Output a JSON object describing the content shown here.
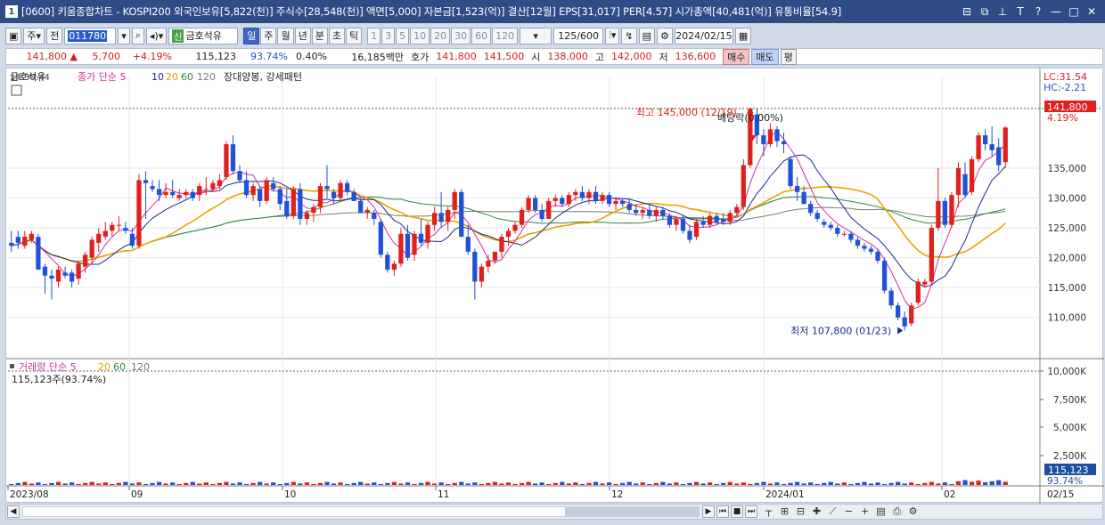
{
  "window": {
    "icon_label": "1",
    "title": "[0600] 키움종합차트 - KOSPI200 외국인보유[5,822(천)] 주식수[28,548(천)] 액면[5,000] 자본금[1,523(억)] 결산[12월] EPS[31,017] PER[4.57] 시가총액[40,481(억)] 유통비율[54.9]",
    "controls": [
      "⊟",
      "⧉",
      "⊥",
      "T",
      "?",
      "—",
      "□",
      "✕"
    ]
  },
  "toolbar": {
    "period_main": "주",
    "prev_label": "전",
    "code": "011780",
    "stock_name": "금호석유",
    "stock_badge": "신",
    "periods": [
      "일",
      "주",
      "월",
      "년",
      "분",
      "초",
      "틱"
    ],
    "active_period": "일",
    "intervals": [
      "1",
      "3",
      "5",
      "10",
      "20",
      "30",
      "60",
      "120"
    ],
    "count": "125/600",
    "date": "2024/02/15"
  },
  "quote": {
    "price": "141,800 ▲",
    "change": "5,700",
    "change_pct": "+4.19%",
    "volume": "115,123",
    "vol_ratio": "93.74%",
    "turnover": "0.40%",
    "amount": "16,185백만",
    "bid_label": "호가",
    "ask1": "141,800",
    "ask2": "141,500",
    "open_label": "시",
    "open": "138,000",
    "high_label": "고",
    "high": "142,000",
    "low_label": "저",
    "low": "136,600",
    "buy_label": "매수",
    "sell_label": "매도",
    "flat_label": "평"
  },
  "chart": {
    "legend_stock": "금호석유",
    "legend_label": "종가 단순",
    "ma_periods": [
      "5",
      "10",
      "20",
      "60",
      "120"
    ],
    "pattern": "장대양봉, 강세패턴",
    "overlay_tag": "14:30:44",
    "lc": "LC:31.54",
    "hc": "HC:-2.21",
    "last_price": "141,800",
    "last_pct": "4.19%",
    "high_ann": "최고 145,000 (12/19)",
    "low_ann": "최저 107,800 (01/23)",
    "div_ann": "배당락(0.00%)",
    "price_ticks": [
      "135,000",
      "130,000",
      "125,000",
      "120,000",
      "115,000",
      "110,000"
    ],
    "vol_legend_label": "거래량 단순",
    "vol_ma": [
      "5",
      "20",
      "60",
      "120"
    ],
    "vol_info": "115,123주(93.74%)",
    "vol_ticks": [
      "10,000K",
      "7,500K",
      "5,000K",
      "2,500K"
    ],
    "vol_last": "115,123",
    "vol_last_pct": "93.74%",
    "x_labels": [
      "2023/08",
      "09",
      "10",
      "11",
      "12",
      "2024/01",
      "02",
      "02/15"
    ],
    "colors": {
      "up": "#e0201c",
      "down": "#1f52d6",
      "ma5": "#d02fa0",
      "ma10": "#1a2a8c",
      "ma20": "#e8a400",
      "ma60": "#2d8a3a",
      "ma120": "#7a7a7a"
    }
  },
  "chart_data": {
    "type": "candlestick",
    "title": "",
    "ylim": [
      104000,
      149000
    ],
    "ohlc": [
      [
        122500,
        124500,
        121000,
        122000
      ],
      [
        123500,
        124500,
        121500,
        122500
      ],
      [
        122000,
        124500,
        121500,
        123500
      ],
      [
        123000,
        124500,
        122500,
        124000
      ],
      [
        123500,
        124000,
        118000,
        118000
      ],
      [
        118500,
        119000,
        114000,
        117000
      ],
      [
        117000,
        118000,
        113000,
        116500
      ],
      [
        116000,
        118500,
        115000,
        118000
      ],
      [
        117500,
        118500,
        116500,
        117000
      ],
      [
        117500,
        118000,
        115000,
        116000
      ],
      [
        116500,
        119500,
        115500,
        119000
      ],
      [
        118500,
        121000,
        117500,
        120500
      ],
      [
        120000,
        123500,
        119000,
        123000
      ],
      [
        122500,
        125000,
        121000,
        124000
      ],
      [
        123500,
        126000,
        123000,
        124500
      ],
      [
        124500,
        126000,
        123500,
        125500
      ],
      [
        125500,
        127000,
        124500,
        125500
      ],
      [
        125000,
        126000,
        124000,
        124500
      ],
      [
        124000,
        125000,
        121500,
        122000
      ],
      [
        122000,
        134000,
        121500,
        133000
      ],
      [
        133000,
        134500,
        126500,
        132500
      ],
      [
        132000,
        133000,
        131000,
        131500
      ],
      [
        131500,
        133000,
        129500,
        130500
      ],
      [
        130500,
        132500,
        130000,
        131000
      ],
      [
        131000,
        133000,
        130000,
        130500
      ],
      [
        130000,
        131500,
        129500,
        130500
      ],
      [
        130500,
        131500,
        130000,
        131000
      ],
      [
        131000,
        131500,
        129500,
        130000
      ],
      [
        130500,
        132500,
        129500,
        132000
      ],
      [
        131500,
        133500,
        130500,
        131500
      ],
      [
        131500,
        133000,
        131000,
        132500
      ],
      [
        132000,
        134000,
        131500,
        133000
      ],
      [
        133500,
        139500,
        133000,
        139000
      ],
      [
        139000,
        140500,
        134000,
        134500
      ],
      [
        134500,
        135500,
        132500,
        133000
      ],
      [
        133000,
        134500,
        130000,
        130500
      ],
      [
        130500,
        132500,
        129500,
        132000
      ],
      [
        131500,
        132000,
        128500,
        129500
      ],
      [
        129500,
        133500,
        129000,
        133000
      ],
      [
        132500,
        133500,
        131000,
        131500
      ],
      [
        131500,
        132000,
        128000,
        129000
      ],
      [
        129500,
        131500,
        126500,
        127000
      ],
      [
        127000,
        132000,
        126500,
        131500
      ],
      [
        131500,
        132500,
        125500,
        126500
      ],
      [
        126500,
        128000,
        125500,
        127500
      ],
      [
        127500,
        129000,
        126000,
        128500
      ],
      [
        128500,
        132500,
        127500,
        132000
      ],
      [
        132000,
        135500,
        130000,
        131500
      ],
      [
        131000,
        131500,
        129000,
        130000
      ],
      [
        130000,
        133000,
        129500,
        132500
      ],
      [
        132500,
        133000,
        130500,
        131000
      ],
      [
        131000,
        131500,
        129500,
        129500
      ],
      [
        129500,
        130000,
        127500,
        127500
      ],
      [
        127500,
        128500,
        126500,
        128000
      ],
      [
        127500,
        128000,
        125500,
        126500
      ],
      [
        126000,
        126500,
        120000,
        120500
      ],
      [
        120500,
        121000,
        117500,
        118000
      ],
      [
        118000,
        119500,
        117000,
        119000
      ],
      [
        119000,
        125000,
        118500,
        124000
      ],
      [
        124000,
        125500,
        119500,
        120000
      ],
      [
        120500,
        124500,
        119500,
        124000
      ],
      [
        124000,
        126500,
        122000,
        122500
      ],
      [
        122500,
        126000,
        121500,
        125500
      ],
      [
        125500,
        128500,
        124500,
        127500
      ],
      [
        127500,
        131000,
        125000,
        126000
      ],
      [
        126000,
        128500,
        124500,
        128000
      ],
      [
        128000,
        131500,
        126500,
        131000
      ],
      [
        131000,
        131500,
        123500,
        123500
      ],
      [
        123500,
        125500,
        120500,
        121000
      ],
      [
        121000,
        121500,
        113000,
        116000
      ],
      [
        116000,
        119000,
        115000,
        118500
      ],
      [
        118500,
        120500,
        117500,
        119500
      ],
      [
        119500,
        121000,
        119000,
        121000
      ],
      [
        121000,
        124000,
        120000,
        123500
      ],
      [
        123500,
        125000,
        122000,
        124500
      ],
      [
        124500,
        126000,
        124000,
        125500
      ],
      [
        125500,
        128500,
        125000,
        128000
      ],
      [
        128000,
        130500,
        127500,
        130000
      ],
      [
        130000,
        130500,
        127500,
        128000
      ],
      [
        128000,
        129000,
        126000,
        126500
      ],
      [
        126500,
        130000,
        126500,
        129500
      ],
      [
        129500,
        130500,
        128500,
        130000
      ],
      [
        130000,
        130500,
        128500,
        129000
      ],
      [
        129000,
        131000,
        128500,
        130500
      ],
      [
        130500,
        131500,
        129500,
        131000
      ],
      [
        131000,
        132000,
        129500,
        130000
      ],
      [
        130000,
        131500,
        129000,
        131000
      ],
      [
        131000,
        132000,
        129000,
        129500
      ],
      [
        129500,
        131000,
        129000,
        130500
      ],
      [
        130500,
        131000,
        128500,
        129000
      ],
      [
        129000,
        130000,
        128000,
        129500
      ],
      [
        129500,
        130000,
        128500,
        129000
      ],
      [
        129000,
        130000,
        127500,
        128000
      ],
      [
        128000,
        129000,
        127000,
        127500
      ],
      [
        127500,
        128500,
        126500,
        128000
      ],
      [
        128000,
        129000,
        126500,
        127000
      ],
      [
        127000,
        128500,
        126000,
        128000
      ],
      [
        128000,
        128500,
        126500,
        127000
      ],
      [
        127000,
        127500,
        125000,
        125500
      ],
      [
        125500,
        127000,
        124500,
        126500
      ],
      [
        126500,
        127000,
        124000,
        124500
      ],
      [
        124500,
        125500,
        122500,
        123000
      ],
      [
        123500,
        126500,
        123000,
        126000
      ],
      [
        126000,
        127000,
        125000,
        125500
      ],
      [
        125500,
        127500,
        125000,
        127000
      ],
      [
        127000,
        127500,
        125500,
        126000
      ],
      [
        126500,
        127500,
        125500,
        126000
      ],
      [
        126000,
        128000,
        125500,
        127500
      ],
      [
        127500,
        129000,
        127000,
        128500
      ],
      [
        128500,
        136500,
        128000,
        135500
      ],
      [
        135500,
        145000,
        135000,
        145000
      ],
      [
        144000,
        145000,
        139000,
        140500
      ],
      [
        140500,
        141500,
        137000,
        139000
      ],
      [
        139000,
        142500,
        138500,
        141500
      ],
      [
        141500,
        142000,
        138500,
        139500
      ],
      [
        139500,
        141000,
        137500,
        139000
      ],
      [
        136500,
        137000,
        131500,
        132000
      ],
      [
        132000,
        133500,
        129500,
        131000
      ],
      [
        131000,
        132000,
        129000,
        129000
      ],
      [
        129000,
        129500,
        127000,
        127500
      ],
      [
        127500,
        128000,
        126000,
        126500
      ],
      [
        126000,
        126500,
        125000,
        125500
      ],
      [
        125500,
        126000,
        124500,
        125000
      ],
      [
        125000,
        125500,
        123500,
        124000
      ],
      [
        124000,
        124500,
        123500,
        124000
      ],
      [
        124000,
        124500,
        122500,
        123000
      ],
      [
        123000,
        123500,
        121500,
        122000
      ],
      [
        122000,
        122500,
        121000,
        121500
      ],
      [
        121500,
        122000,
        120500,
        121000
      ],
      [
        121000,
        121500,
        119000,
        119500
      ],
      [
        119500,
        120000,
        114000,
        114500
      ],
      [
        114500,
        115000,
        111500,
        112000
      ],
      [
        112000,
        112500,
        109500,
        110000
      ],
      [
        110000,
        111000,
        107800,
        108500
      ],
      [
        109000,
        112500,
        108500,
        112000
      ],
      [
        112500,
        116500,
        112000,
        116000
      ],
      [
        115500,
        116500,
        115000,
        116000
      ],
      [
        116000,
        125500,
        115500,
        125000
      ],
      [
        125000,
        135000,
        124500,
        129500
      ],
      [
        129500,
        130000,
        125000,
        125500
      ],
      [
        125500,
        131000,
        125000,
        130500
      ],
      [
        130500,
        136000,
        128500,
        135000
      ],
      [
        134000,
        136000,
        130000,
        130500
      ],
      [
        131000,
        137000,
        130500,
        136500
      ],
      [
        136500,
        141000,
        136000,
        140500
      ],
      [
        140500,
        141500,
        138000,
        139000
      ],
      [
        139000,
        142000,
        137000,
        138000
      ],
      [
        138500,
        140000,
        134500,
        135500
      ],
      [
        136000,
        142000,
        135000,
        141800
      ]
    ]
  }
}
